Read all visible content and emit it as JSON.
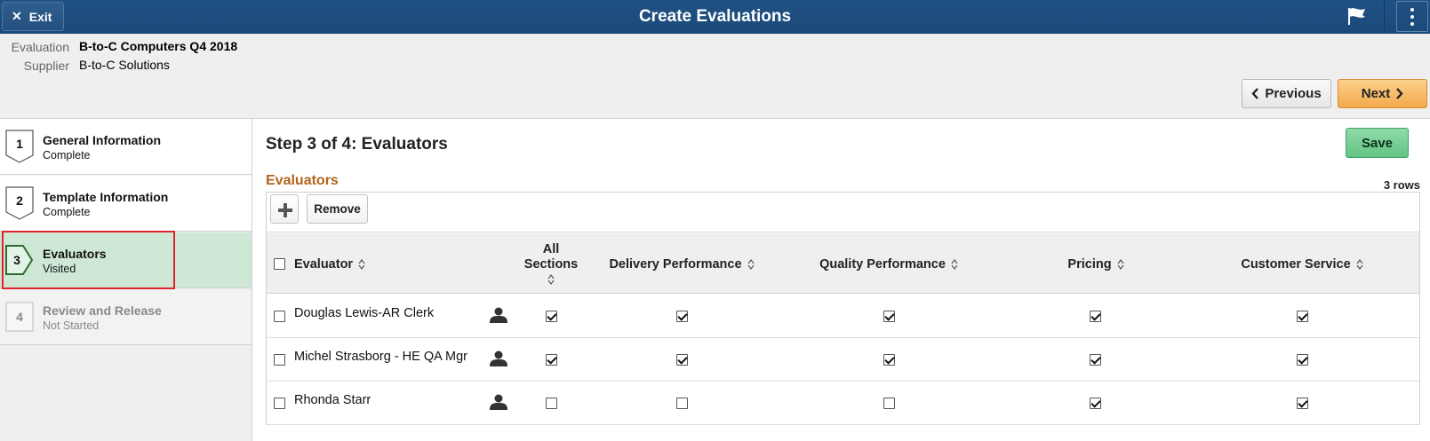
{
  "header": {
    "exit_label": "Exit",
    "title": "Create Evaluations"
  },
  "info": {
    "evaluation_label": "Evaluation",
    "evaluation_value": "B-to-C Computers  Q4 2018",
    "supplier_label": "Supplier",
    "supplier_value": "B-to-C Solutions"
  },
  "nav": {
    "previous_label": "Previous",
    "next_label": "Next"
  },
  "steps": [
    {
      "number": "1",
      "title": "General Information",
      "status": "Complete"
    },
    {
      "number": "2",
      "title": "Template Information",
      "status": "Complete"
    },
    {
      "number": "3",
      "title": "Evaluators",
      "status": "Visited"
    },
    {
      "number": "4",
      "title": "Review and Release",
      "status": "Not Started"
    }
  ],
  "main": {
    "title": "Step 3 of 4: Evaluators",
    "save_label": "Save",
    "section_title": "Evaluators",
    "row_count": "3 rows",
    "remove_label": "Remove"
  },
  "table": {
    "columns": {
      "evaluator": "Evaluator",
      "all_sections_line1": "All",
      "all_sections_line2": "Sections",
      "delivery": "Delivery Performance",
      "quality": "Quality Performance",
      "pricing": "Pricing",
      "customer": "Customer Service"
    },
    "rows": [
      {
        "name": "Douglas Lewis-AR Clerk",
        "all": true,
        "delivery": true,
        "quality": true,
        "pricing": true,
        "customer": true
      },
      {
        "name": "Michel Strasborg - HE QA Mgr",
        "all": true,
        "delivery": true,
        "quality": true,
        "pricing": true,
        "customer": true
      },
      {
        "name": "Rhonda Starr",
        "all": false,
        "delivery": false,
        "quality": false,
        "pricing": true,
        "customer": true
      }
    ]
  },
  "colors": {
    "header_bg": "#205183",
    "active_step_bg": "#cfe8d6",
    "section_title": "#b1651c",
    "next_button": "#f4a94b",
    "save_button": "#63c384",
    "highlight_border": "#e0242d"
  }
}
